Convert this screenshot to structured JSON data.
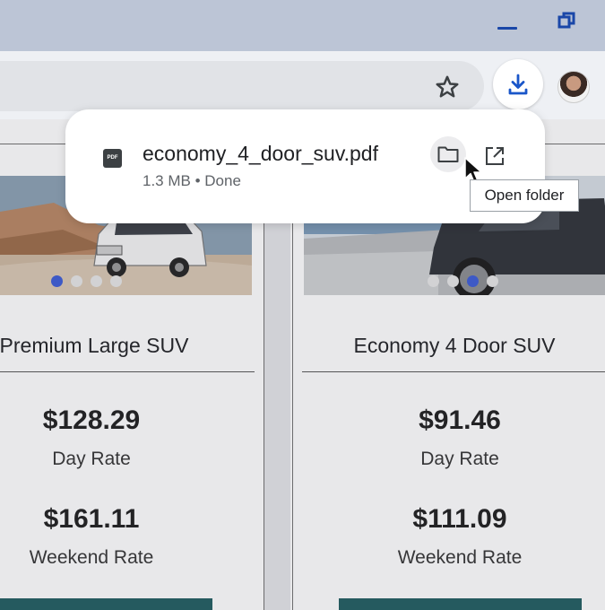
{
  "download": {
    "file_name": "economy_4_door_suv.pdf",
    "status": "1.3 MB • Done",
    "file_type_label": "PDF",
    "tooltip": "Open folder"
  },
  "cards": [
    {
      "title": "Premium Large SUV",
      "day_price": "$128.29",
      "day_label": "Day Rate",
      "weekend_price": "$161.11",
      "weekend_label": "Weekend Rate",
      "carousel_active_index": 0,
      "carousel_count": 4
    },
    {
      "title": "Economy 4 Door SUV",
      "day_price": "$91.46",
      "day_label": "Day Rate",
      "weekend_price": "$111.09",
      "weekend_label": "Weekend Rate",
      "carousel_active_index": 2,
      "carousel_count": 4
    }
  ],
  "colors": {
    "accent": "#3b5bd6",
    "download_icon": "#1a56c9",
    "cta": "#1f5c60"
  },
  "icons": [
    "minimize-icon",
    "restore-icon",
    "star-icon",
    "download-icon",
    "pdf-icon",
    "folder-icon",
    "open-external-icon",
    "cursor-icon"
  ]
}
